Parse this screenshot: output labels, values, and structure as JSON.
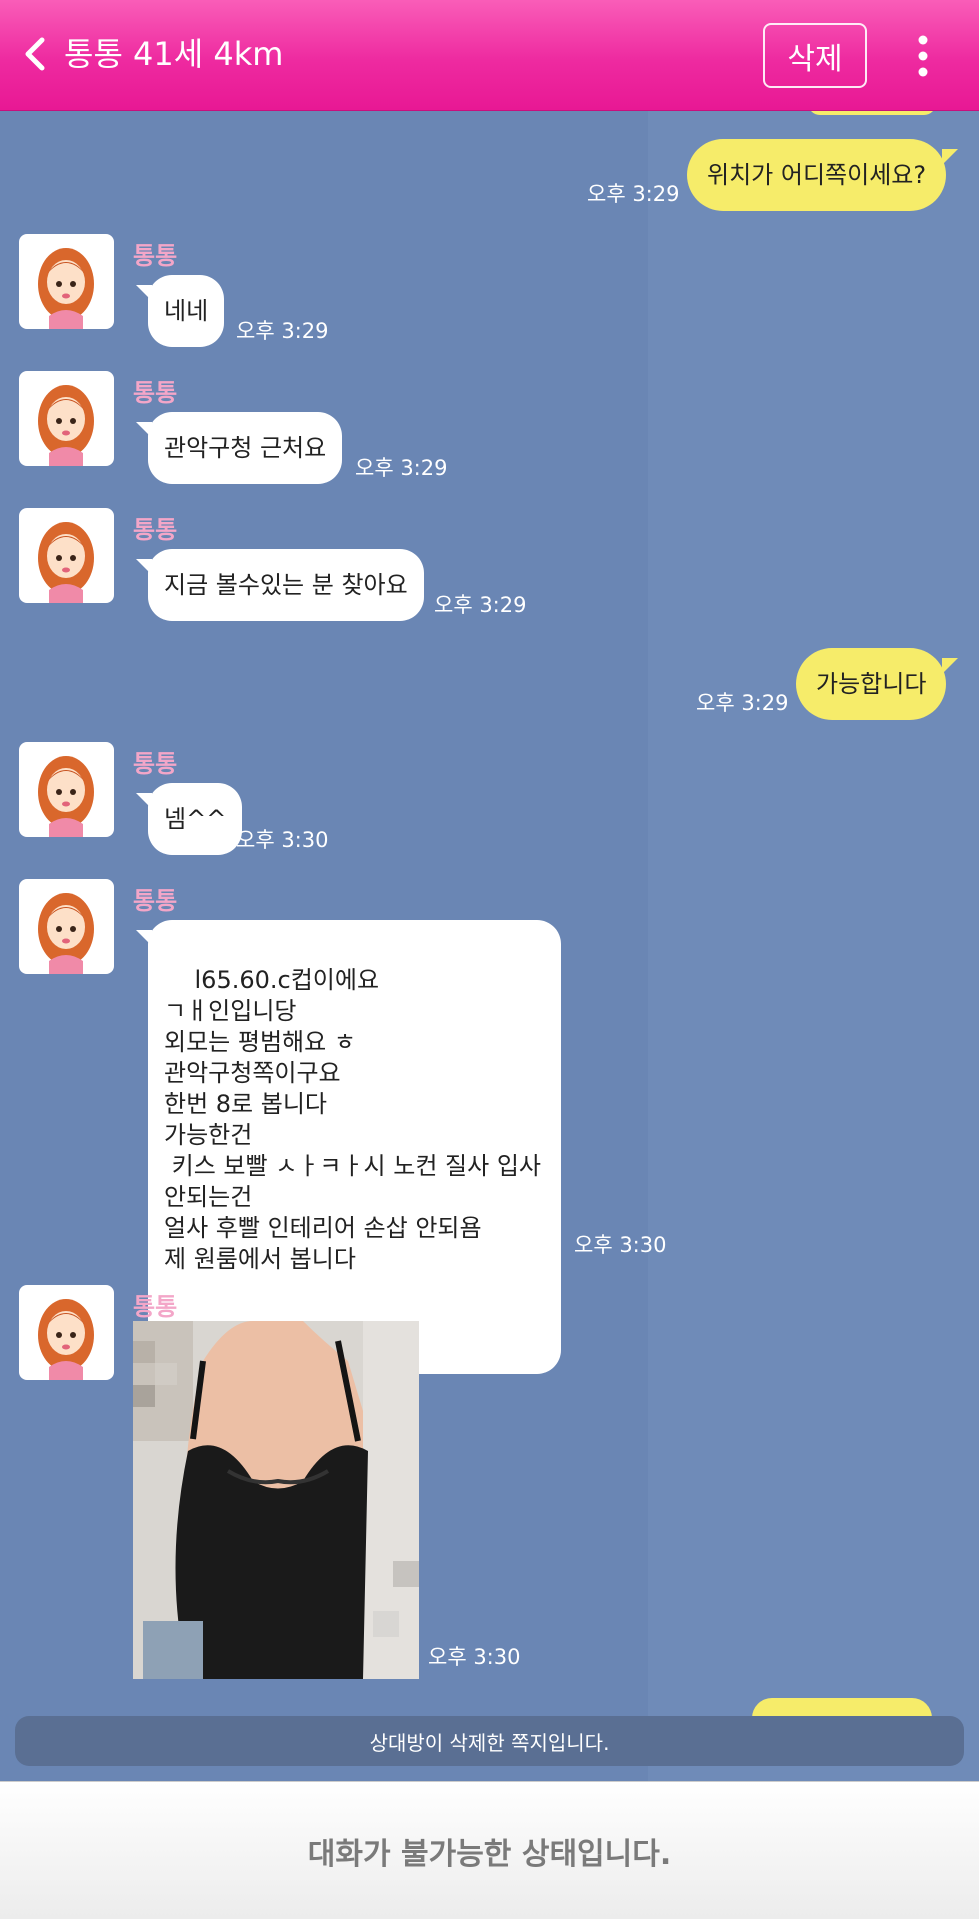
{
  "header": {
    "title": "통통 41세 4km",
    "delete_label": "삭제"
  },
  "messages": [
    {
      "type": "out",
      "text": "위치가 어디쪽이세요?",
      "time": "오후 3:29"
    },
    {
      "type": "in",
      "sender": "통통",
      "text": "네네",
      "time": "오후 3:29"
    },
    {
      "type": "in",
      "sender": "통통",
      "text": "관악구청 근처요",
      "time": "오후 3:29"
    },
    {
      "type": "in",
      "sender": "통통",
      "text": "지금 볼수있는 분 찾아요",
      "time": "오후 3:29"
    },
    {
      "type": "out",
      "text": "가능합니다",
      "time": "오후 3:29"
    },
    {
      "type": "in",
      "sender": "통통",
      "text": "넴^^",
      "time": "오후 3:30"
    },
    {
      "type": "in",
      "sender": "통통",
      "text": "l65.60.c컵이에요\nㄱㅐ인입니당\n외모는 평범해요 ㅎ\n관악구청쪽이구요\n한번 8로 봅니다\n가능한건\n 키스 보빨 ㅅㅏㅋㅏ시 노컨 질사 입사\n안되는건\n얼사 후빨 인테리어 손삽 안되욤\n제 원룸에서 봅니다",
      "time": "오후 3:30"
    },
    {
      "type": "in-photo",
      "sender": "통통",
      "time": "오후 3:30"
    }
  ],
  "notice": "상대방이 삭제한 쪽지입니다.",
  "footer": "대화가 불가능한 상태입니다.",
  "colors": {
    "header": "#ee2aa0",
    "chat_bg": "#6a86b4",
    "out_bubble": "#f6ec6a",
    "in_bubble": "#ffffff",
    "sender": "#f3a6c8"
  }
}
